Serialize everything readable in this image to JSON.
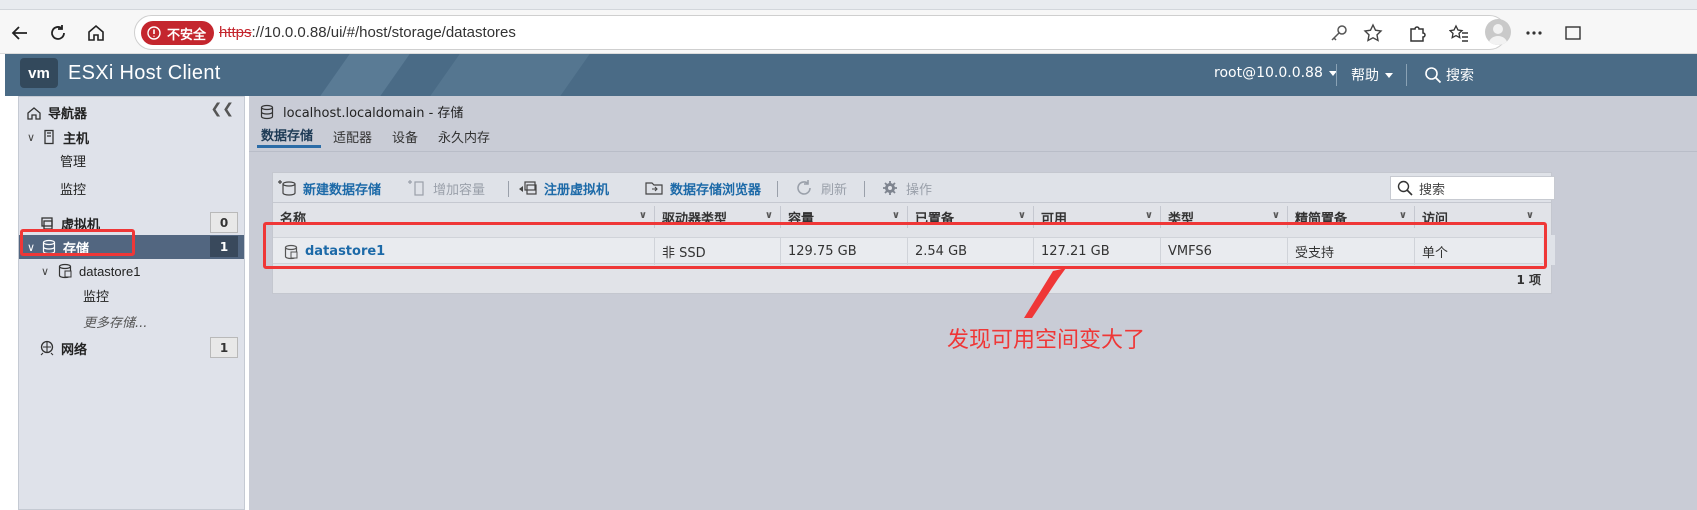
{
  "browser": {
    "security_label": "不安全",
    "url_protocol": "https",
    "url_rest": "://10.0.0.88/ui/#/host/storage/datastores"
  },
  "header": {
    "logo": "vm",
    "title": "ESXi Host Client",
    "user": "root@10.0.0.88",
    "help": "帮助",
    "search": "搜索"
  },
  "sidebar": {
    "title": "导航器",
    "items": {
      "host": "主机",
      "manage": "管理",
      "monitor": "监控",
      "vms": "虚拟机",
      "vms_count": "0",
      "storage": "存储",
      "storage_count": "1",
      "datastore": "datastore1",
      "ds_monitor": "监控",
      "more_storage": "更多存储...",
      "network": "网络",
      "network_count": "1"
    }
  },
  "main": {
    "title": "localhost.localdomain - 存储",
    "tabs": [
      "数据存储",
      "适配器",
      "设备",
      "永久内存"
    ],
    "toolbar": {
      "new_datastore": "新建数据存储",
      "increase_capacity": "增加容量",
      "register_vm": "注册虚拟机",
      "datastore_browser": "数据存储浏览器",
      "refresh": "刷新",
      "actions": "操作",
      "search_placeholder": "搜索"
    },
    "table": {
      "columns": [
        "名称",
        "驱动器类型",
        "容量",
        "已置备",
        "可用",
        "类型",
        "精简置备",
        "访问"
      ],
      "row": [
        "datastore1",
        "非 SSD",
        "129.75 GB",
        "2.54 GB",
        "127.21 GB",
        "VMFS6",
        "受支持",
        "单个"
      ],
      "footer": "1 项"
    }
  },
  "annotation": {
    "text": "发现可用空间变大了",
    "color": "#ef3737"
  }
}
